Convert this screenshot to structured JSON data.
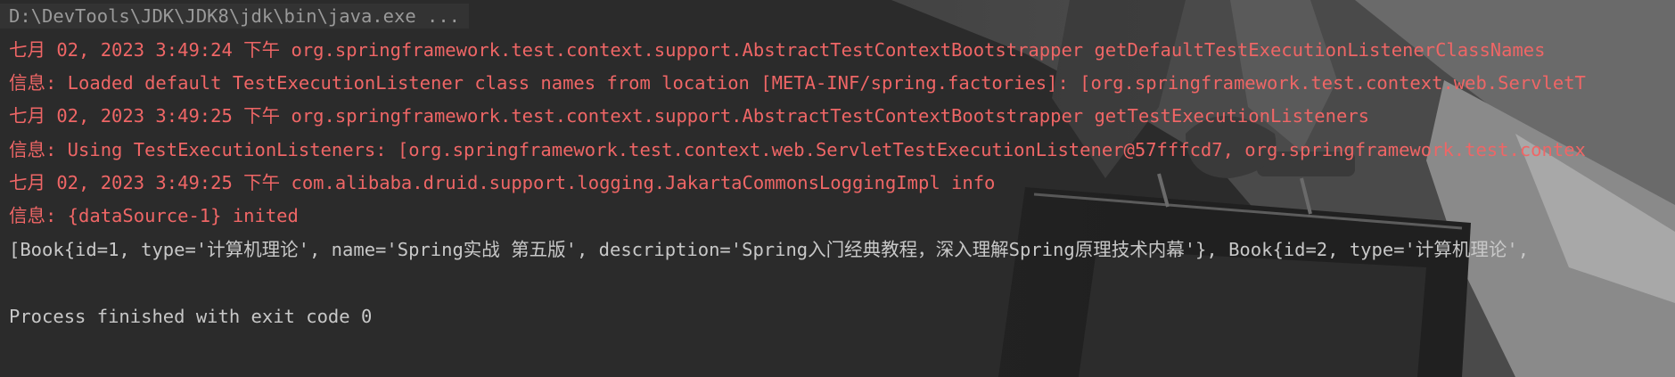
{
  "console": {
    "command": "D:\\DevTools\\JDK\\JDK8\\jdk\\bin\\java.exe ...",
    "lines": [
      "七月 02, 2023 3:49:24 下午 org.springframework.test.context.support.AbstractTestContextBootstrapper getDefaultTestExecutionListenerClassNames",
      "信息: Loaded default TestExecutionListener class names from location [META-INF/spring.factories]: [org.springframework.test.context.web.ServletT",
      "七月 02, 2023 3:49:25 下午 org.springframework.test.context.support.AbstractTestContextBootstrapper getTestExecutionListeners",
      "信息: Using TestExecutionListeners: [org.springframework.test.context.web.ServletTestExecutionListener@57fffcd7, org.springframework.test.contex",
      "七月 02, 2023 3:49:25 下午 com.alibaba.druid.support.logging.JakartaCommonsLoggingImpl info",
      "信息: {dataSource-1} inited",
      "[Book{id=1, type='计算机理论', name='Spring实战 第五版', description='Spring入门经典教程，深入理解Spring原理技术内幕'}, Book{id=2, type='计算机理论',",
      "Process finished with exit code 0"
    ]
  },
  "colors": {
    "background": "#2b2b2b",
    "stderr_text": "#ef6666",
    "stdout_text": "#c8c8c8",
    "command_text": "#9a9a9a"
  }
}
